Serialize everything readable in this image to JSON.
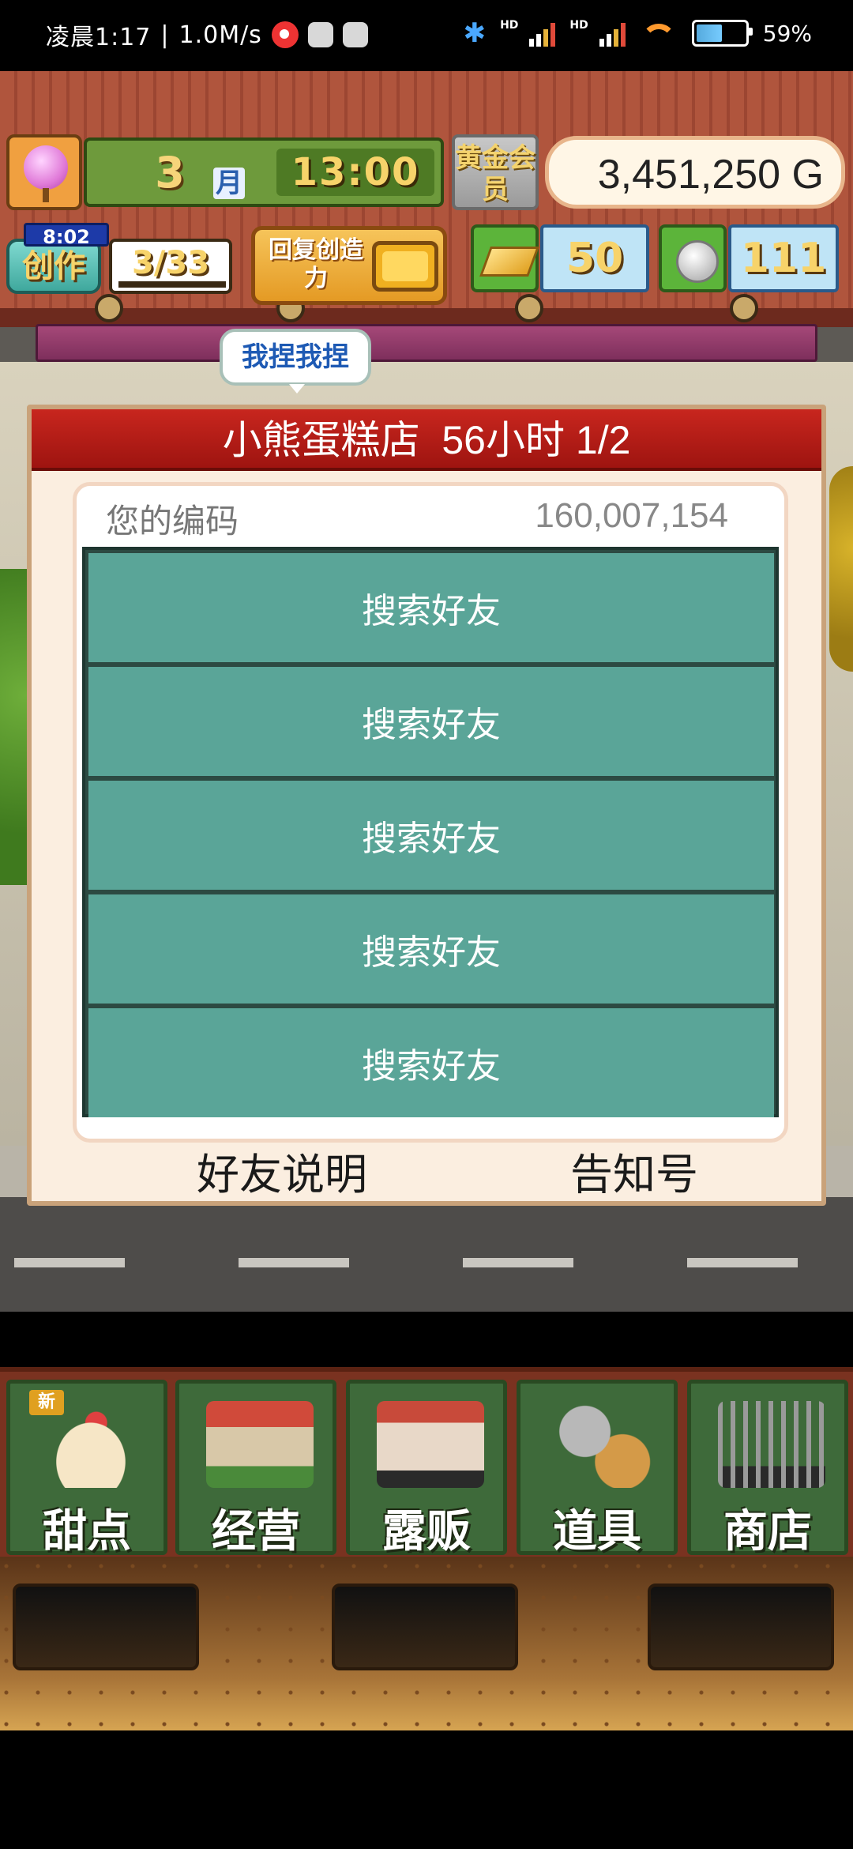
{
  "status_bar": {
    "time": "凌晨1:17",
    "net_speed": "1.0M/s",
    "hd1": "HD",
    "hd2": "HD",
    "battery": "59%",
    "battery_level": 0.59
  },
  "hud": {
    "month_number": "3",
    "month_label": "月",
    "clock": "13:00",
    "gold_member_label": "黄金会员",
    "money": "3,451,250 G",
    "create": {
      "timer": "8:02",
      "label": "创作",
      "count": "3/33"
    },
    "restore_button": "回复创造力",
    "gold_bars": "50",
    "coins": "111",
    "speech_bubble": "我捏我捏"
  },
  "dialog": {
    "title": "小熊蛋糕店  56小时 1/2",
    "code_label": "您的编码",
    "code_value": "160,007,154",
    "friend_slots": [
      {
        "label": "搜索好友"
      },
      {
        "label": "搜索好友"
      },
      {
        "label": "搜索好友"
      },
      {
        "label": "搜索好友"
      },
      {
        "label": "搜索好友"
      }
    ],
    "footer_left": "好友说明",
    "footer_right": "告知号"
  },
  "bottom_nav": {
    "items": [
      {
        "label": "甜点",
        "icon": "cake-icon",
        "badge": "新"
      },
      {
        "label": "经营",
        "icon": "shop-building-icon"
      },
      {
        "label": "露贩",
        "icon": "food-truck-icon"
      },
      {
        "label": "道具",
        "icon": "gear-and-bag-icon"
      },
      {
        "label": "商店",
        "icon": "shopping-cart-icon"
      }
    ]
  }
}
